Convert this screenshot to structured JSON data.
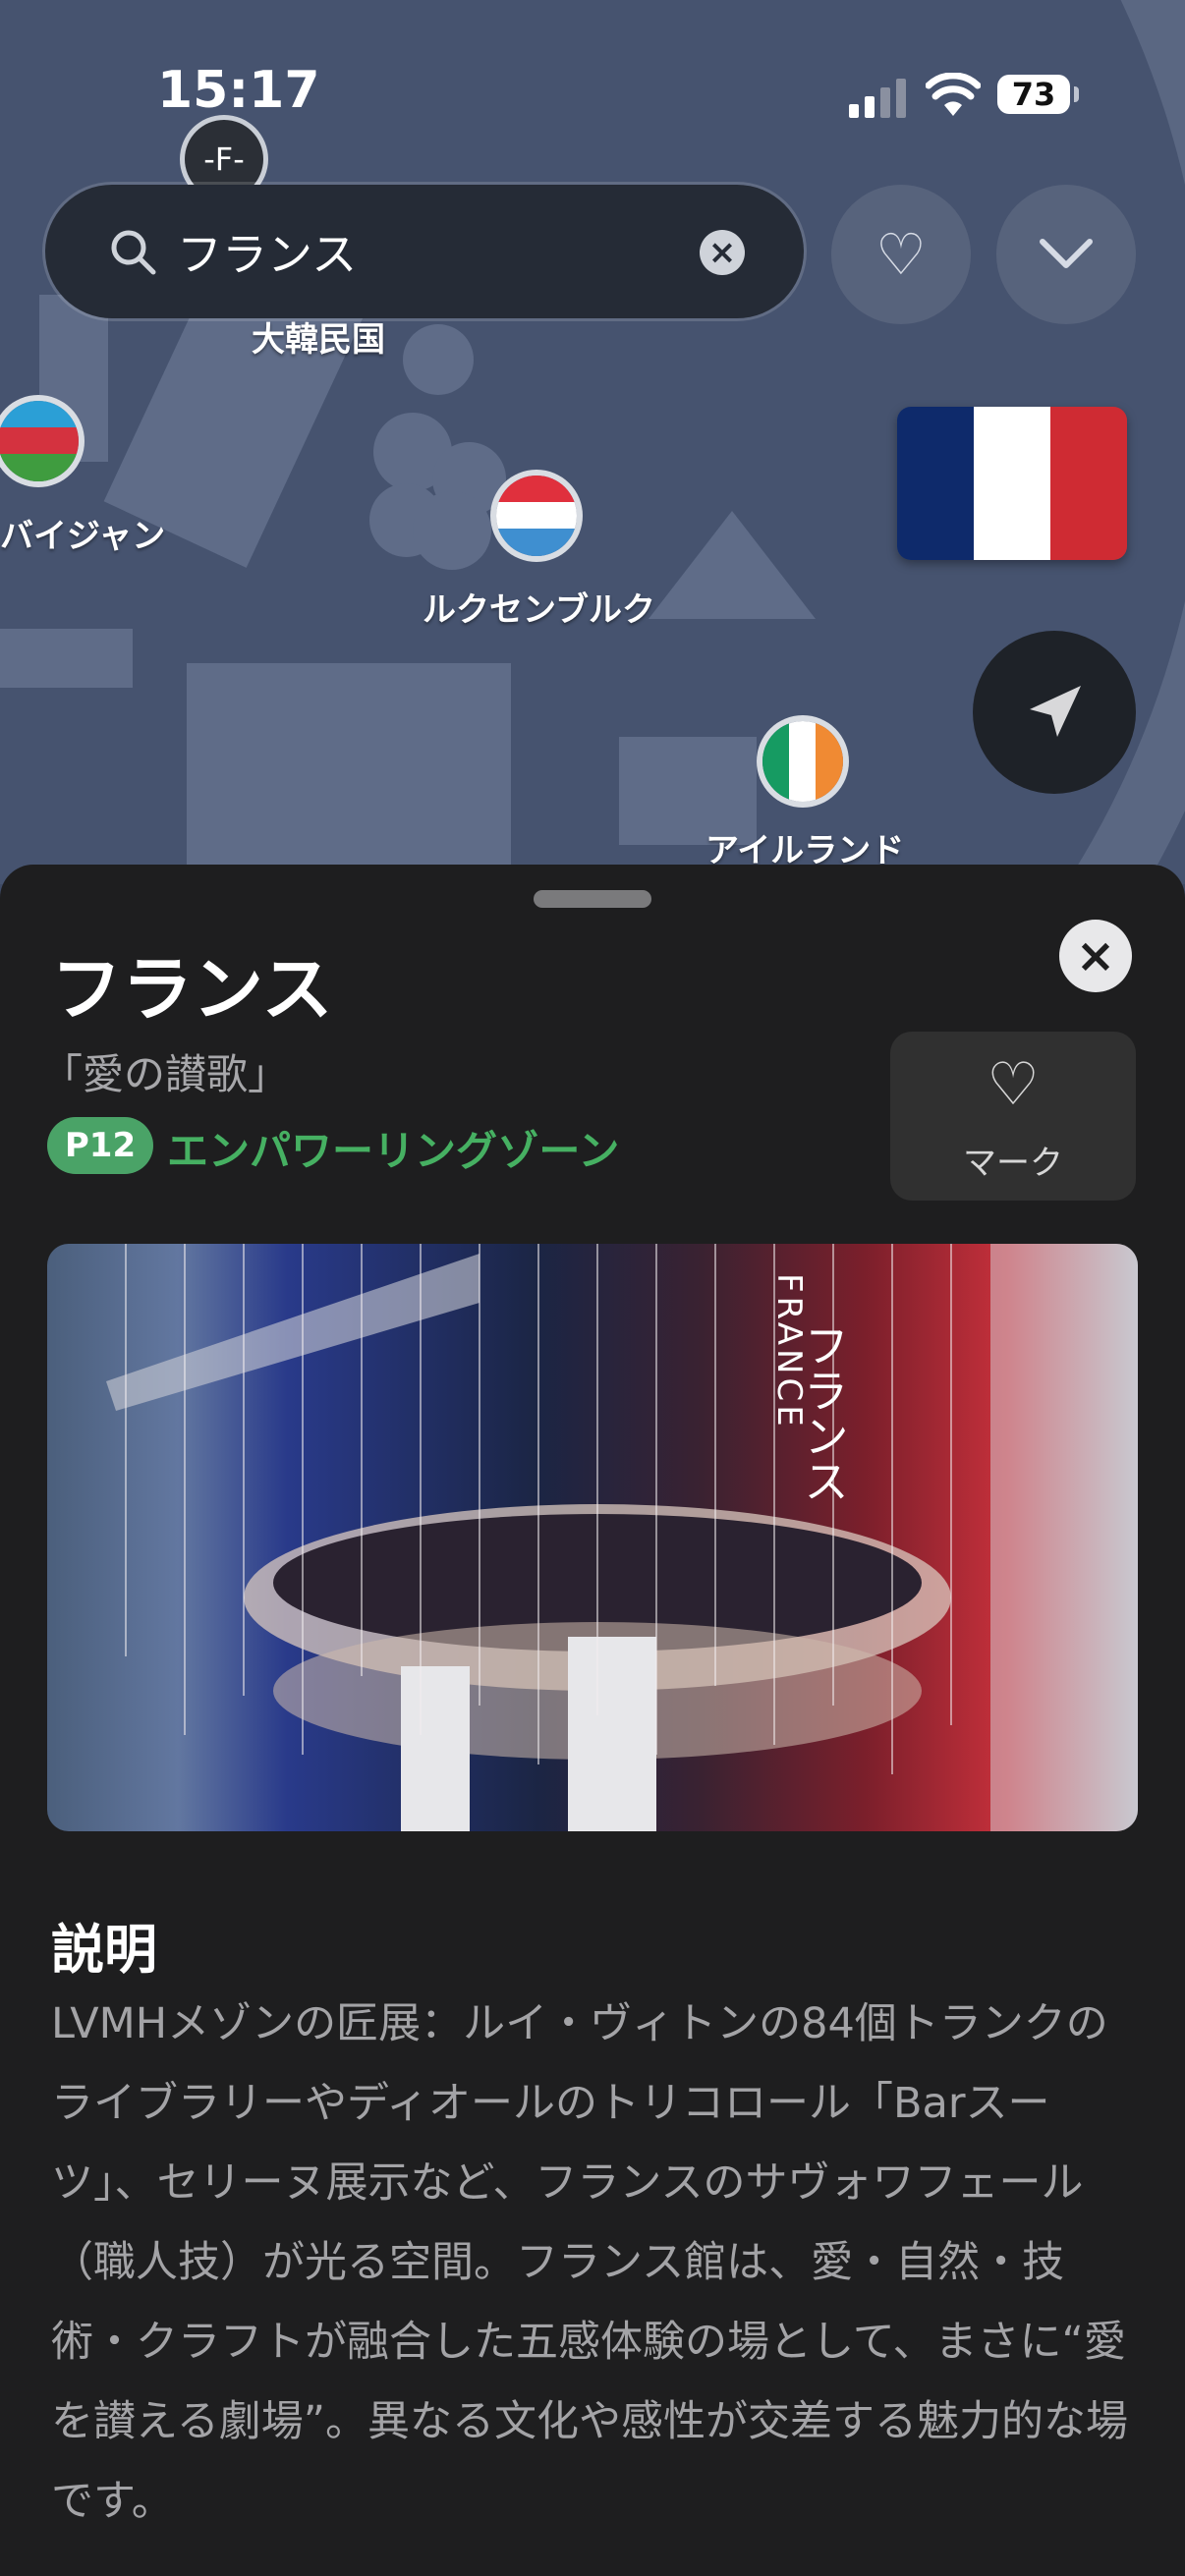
{
  "status": {
    "time": "15:17",
    "battery": "73"
  },
  "search": {
    "value": "フランス"
  },
  "map": {
    "markers": [
      {
        "label": "大韓民国",
        "icon": "korea-flag-icon"
      },
      {
        "label": "バイジャン",
        "icon": "azerbaijan-flag-icon"
      },
      {
        "label": "ルクセンブルク",
        "icon": "luxembourg-flag-icon"
      },
      {
        "label": "アイルランド",
        "icon": "ireland-flag-icon"
      }
    ],
    "floor_label": "-F-"
  },
  "panel": {
    "title": "フランス",
    "subtitle": "「愛の讃歌」",
    "badge": "P12",
    "zone": "エンパワーリングゾーン",
    "mark_label": "マーク",
    "description_heading": "説明",
    "description": "LVMHメゾンの匠展：ルイ・ヴィトンの84個トランクのライブラリーやディオールのトリコロール「Barスーツ」、セリーヌ展示など、フランスのサヴォワフェール（職人技）が光る空間。フランス館は、愛・自然・技術・クラフトが融合した五感体験の場として、まさに“愛を讃える劇場”。異なる文化や感性が交差する魅力的な場です。"
  },
  "colors": {
    "accent_green": "#46b062",
    "panel_bg": "#1e1e1f",
    "map_bg": "#46536f"
  }
}
